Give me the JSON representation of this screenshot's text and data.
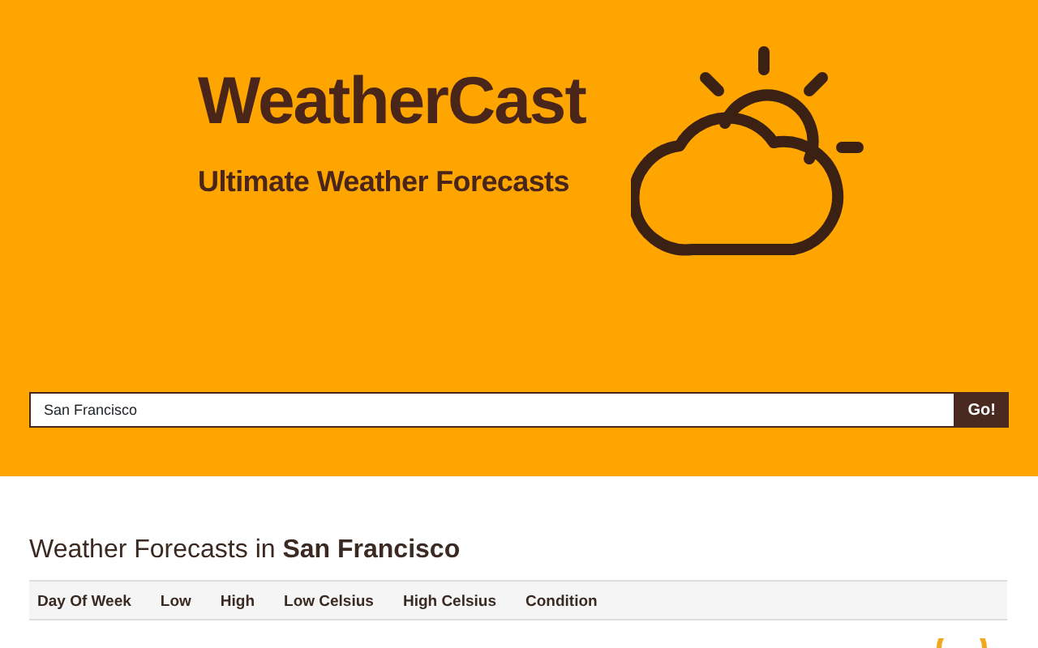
{
  "header": {
    "title": "WeatherCast",
    "subtitle": "Ultimate Weather Forecasts"
  },
  "search": {
    "value": "San Francisco",
    "button": "Go!"
  },
  "forecast": {
    "heading": "Weather Forecasts in **San Francisco**",
    "columns": [
      "Day Of Week",
      "Low",
      "High",
      "Low Celsius",
      "High Celsius",
      "Condition"
    ]
  }
}
